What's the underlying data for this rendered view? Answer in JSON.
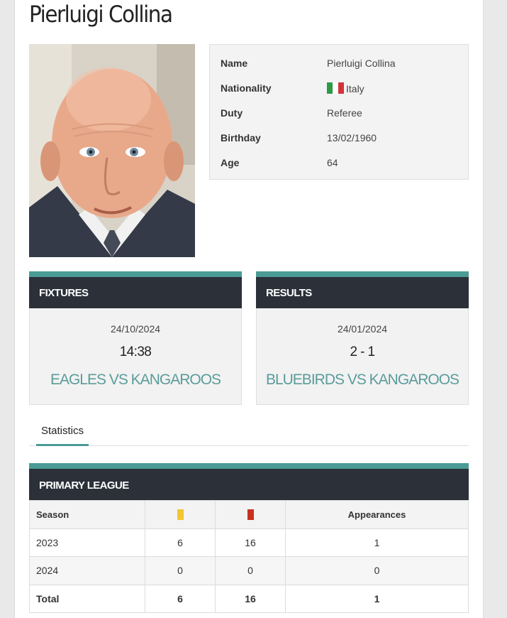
{
  "person": {
    "name_title": "Pierluigi Collina"
  },
  "info": [
    {
      "key": "Name",
      "value": "Pierluigi Collina"
    },
    {
      "key": "Nationality",
      "value": "Italy",
      "flag": [
        "#2e9a48",
        "#ffffff",
        "#d4333a"
      ]
    },
    {
      "key": "Duty",
      "value": "Referee"
    },
    {
      "key": "Birthday",
      "value": "13/02/1960"
    },
    {
      "key": "Age",
      "value": "64"
    }
  ],
  "fixtures": {
    "heading": "FIXTURES",
    "date": "24/10/2024",
    "time": "14:38",
    "match": "EAGLES VS KANGAROOS"
  },
  "results": {
    "heading": "RESULTS",
    "date": "24/01/2024",
    "score": "2 - 1",
    "match": "BLUEBIRDS VS KANGAROOS"
  },
  "tabs": {
    "statistics": "Statistics"
  },
  "league": {
    "heading": "PRIMARY LEAGUE",
    "columns": {
      "season": "Season",
      "yellow_icon": "yellow-card-icon",
      "red_icon": "red-card-icon",
      "appearances": "Appearances"
    },
    "rows": [
      {
        "season": "2023",
        "yellow": "6",
        "red": "16",
        "appearances": "1"
      },
      {
        "season": "2024",
        "yellow": "0",
        "red": "0",
        "appearances": "0"
      }
    ],
    "total": {
      "season": "Total",
      "yellow": "6",
      "red": "16",
      "appearances": "1"
    }
  },
  "colors": {
    "accent": "#4a9b96",
    "header_dark": "#2b3039",
    "match_text": "#5b9c9a",
    "yellow_card": "#f2c62f",
    "red_card": "#c9301f"
  }
}
